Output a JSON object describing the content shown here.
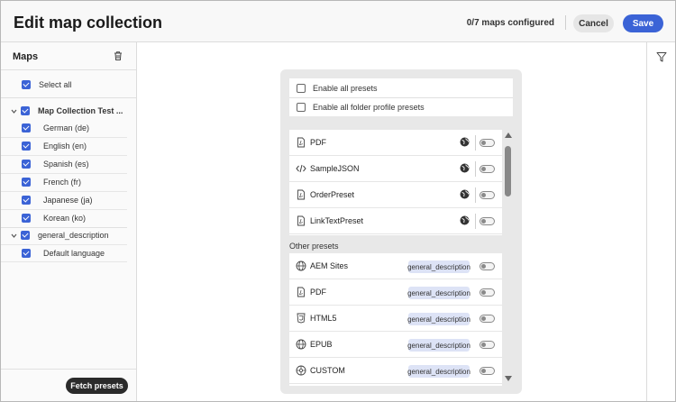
{
  "header": {
    "title": "Edit map collection",
    "maps_configured": "0/7 maps configured",
    "cancel_label": "Cancel",
    "save_label": "Save"
  },
  "sidebar": {
    "title": "Maps",
    "select_all_label": "Select all",
    "groups": [
      {
        "label": "Map Collection Test ...",
        "checked": true,
        "expanded": true,
        "items": [
          {
            "label": "German (de)",
            "checked": true
          },
          {
            "label": "English (en)",
            "checked": true
          },
          {
            "label": "Spanish (es)",
            "checked": true
          },
          {
            "label": "French (fr)",
            "checked": true
          },
          {
            "label": "Japanese (ja)",
            "checked": true
          },
          {
            "label": "Korean (ko)",
            "checked": true
          }
        ]
      },
      {
        "label": "general_description",
        "checked": true,
        "expanded": true,
        "items": [
          {
            "label": "Default language",
            "checked": true
          }
        ]
      }
    ],
    "fetch_label": "Fetch presets"
  },
  "presets": {
    "enable_all_label": "Enable all presets",
    "enable_folder_label": "Enable all folder profile presets",
    "folder_presets": [
      {
        "name": "PDF",
        "icon": "pdf-icon",
        "enabled": false
      },
      {
        "name": "SampleJSON",
        "icon": "code-icon",
        "enabled": false
      },
      {
        "name": "OrderPreset",
        "icon": "pdf-icon",
        "enabled": false
      },
      {
        "name": "LinkTextPreset",
        "icon": "pdf-icon",
        "enabled": false
      }
    ],
    "other_presets_label": "Other presets",
    "other_presets": [
      {
        "name": "AEM Sites",
        "icon": "globe-icon",
        "badge": "general_description",
        "enabled": false
      },
      {
        "name": "PDF",
        "icon": "pdf-icon",
        "badge": "general_description",
        "enabled": false
      },
      {
        "name": "HTML5",
        "icon": "html5-icon",
        "badge": "general_description",
        "enabled": false
      },
      {
        "name": "EPUB",
        "icon": "globe-icon",
        "badge": "general_description",
        "enabled": false
      },
      {
        "name": "CUSTOM",
        "icon": "custom-icon",
        "badge": "general_description",
        "enabled": false
      }
    ]
  },
  "colors": {
    "accent": "#3b63d6",
    "badge_bg": "#dde3f6",
    "dark_button": "#2b2b2b"
  }
}
